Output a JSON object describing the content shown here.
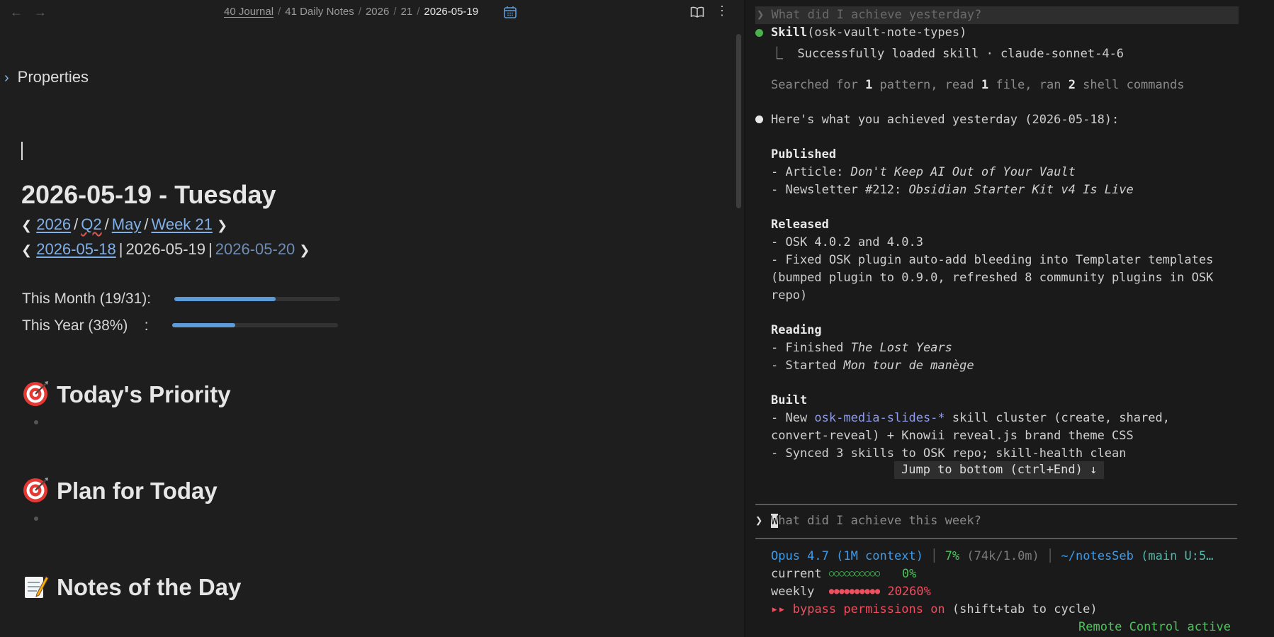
{
  "breadcrumb": [
    "40 Journal",
    "41 Daily Notes",
    "2026",
    "21",
    "2026-05-19"
  ],
  "note": {
    "properties_label": "Properties",
    "title": "2026-05-19 - Tuesday",
    "period_nav": [
      "2026",
      "Q2",
      "May",
      "Week 21"
    ],
    "day_nav": {
      "prev": "2026-05-18",
      "current": "2026-05-19",
      "next": "2026-05-20"
    },
    "progress": [
      {
        "label": "This Month (19/31):",
        "fraction": 0.6129
      },
      {
        "label": "This Year (38%)    :",
        "fraction": 0.38
      }
    ],
    "headings": [
      {
        "emoji_icon": "direct-hit-icon",
        "text": "Today's Priority"
      },
      {
        "emoji_icon": "direct-hit-icon",
        "text": "Plan for Today"
      },
      {
        "emoji_icon": "memo-icon",
        "text": "Notes of the Day"
      }
    ]
  },
  "terminal": {
    "prev_prompt": "❯ What did I achieve yesterday?",
    "skill_name": "Skill",
    "skill_arg": "(osk-vault-note-types)",
    "skill_result": "⎿  Successfully loaded skill · claude-sonnet-4-6",
    "search_summary": {
      "a": "Searched for ",
      "n1": "1",
      "b": " pattern, read ",
      "n2": "1",
      "c": " file, ran ",
      "n3": "2",
      "d": " shell commands"
    },
    "answer_intro": "Here's what you achieved yesterday (2026-05-18):",
    "published_heading": "Published",
    "published_1_pre": "- Article: ",
    "published_1_title": "Don't Keep AI Out of Your Vault",
    "published_2_pre": "- Newsletter #212: ",
    "published_2_title": "Obsidian Starter Kit v4 Is Live",
    "released_heading": "Released",
    "released_1": "- OSK 4.0.2 and 4.0.3",
    "released_2": "- Fixed OSK plugin auto-add bleeding into Templater templates",
    "released_3": "(bumped plugin to 0.9.0, refreshed 8 community plugins in OSK",
    "released_4": "repo)",
    "reading_heading": "Reading",
    "reading_1_pre": "- Finished ",
    "reading_1_title": "The Lost Years",
    "reading_2_pre": "- Started ",
    "reading_2_title": "Mon tour de manège",
    "built_heading": "Built",
    "built_1_pre": "- New ",
    "built_1_code": "osk-media-slides-*",
    "built_1_post": " skill cluster (create, shared,",
    "built_2": "convert-reveal) + Knowii reveal.js brand theme CSS",
    "built_3": "- Synced 3 skills to OSK repo; skill-health clean",
    "jump_button": "Jump to bottom (ctrl+End) ↓",
    "input_caret": "❯",
    "input_first_char": "W",
    "input_placeholder_rest": "hat did I achieve this week?",
    "status": {
      "model": "Opus 4.7 (1M context)",
      "context_pct": "7%",
      "context_tokens": "(74k/1.0m)",
      "path": "~/notesSeb",
      "git": "(main U:5…",
      "current_label": "current",
      "current_dots": "○○○○○○○○○○",
      "current_pct": "0%",
      "weekly_label": "weekly",
      "weekly_dots": "●●●●●●●●●●",
      "weekly_pct": "20260%",
      "bypass_arrows": "▸▸",
      "bypass_text": "bypass permissions on",
      "bypass_hint": "(shift+tab to cycle)",
      "remote": "Remote Control active"
    }
  },
  "colors": {
    "accent_link": "#7fb0e8",
    "progress_fill": "#5b9bd8",
    "terminal_green": "#4cc35a",
    "terminal_red": "#ef4f5f",
    "terminal_blue": "#3d9be9"
  }
}
